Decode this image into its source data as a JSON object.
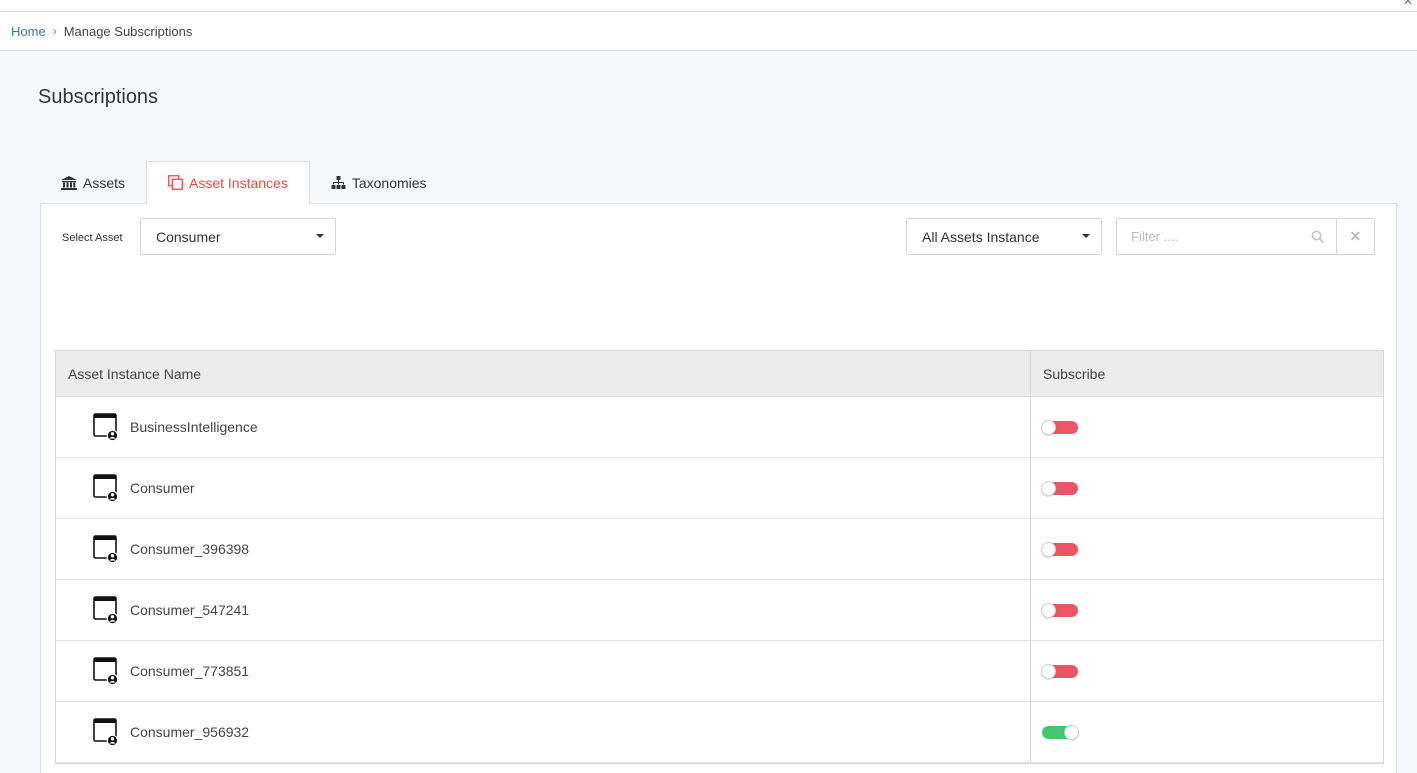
{
  "breadcrumb": {
    "home": "Home",
    "current": "Manage Subscriptions"
  },
  "page": {
    "title": "Subscriptions"
  },
  "tabs": [
    {
      "label": "Assets",
      "icon": "bank-icon",
      "active": false
    },
    {
      "label": "Asset Instances",
      "icon": "copy-icon",
      "active": true
    },
    {
      "label": "Taxonomies",
      "icon": "hierarchy-icon",
      "active": false
    }
  ],
  "controls": {
    "select_asset_label": "Select Asset",
    "selected_asset": "Consumer",
    "instance_filter": "All Assets Instance",
    "filter_placeholder": "Filter ...."
  },
  "table": {
    "headers": {
      "name": "Asset Instance Name",
      "subscribe": "Subscribe"
    },
    "rows": [
      {
        "name": "BusinessIntelligence",
        "subscribed": false
      },
      {
        "name": "Consumer",
        "subscribed": false
      },
      {
        "name": "Consumer_396398",
        "subscribed": false
      },
      {
        "name": "Consumer_547241",
        "subscribed": false
      },
      {
        "name": "Consumer_773851",
        "subscribed": false
      },
      {
        "name": "Consumer_956932",
        "subscribed": true
      }
    ]
  },
  "colors": {
    "accent": "#e34b4b",
    "toggle_off": "#ec5565",
    "toggle_on": "#3ec96b",
    "link": "#3b73b9"
  }
}
